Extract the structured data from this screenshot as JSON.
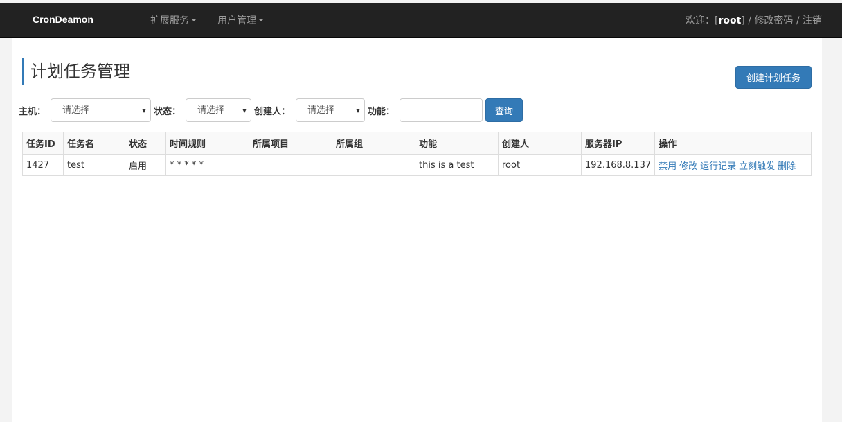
{
  "navbar": {
    "brand": "CronDeamon",
    "menu": [
      {
        "label": "扩展服务"
      },
      {
        "label": "用户管理"
      }
    ],
    "welcome_prefix": "欢迎：[",
    "username": "root",
    "welcome_suffix": "] / ",
    "change_password": "修改密码",
    "separator": " / ",
    "logout": "注销"
  },
  "page": {
    "title": "计划任务管理",
    "create_button": "创建计划任务"
  },
  "filters": {
    "host_label": "主机：",
    "host_value": "请选择",
    "status_label": "状态：",
    "status_value": "请选择",
    "creator_label": "创建人：",
    "creator_value": "请选择",
    "function_label": "功能：",
    "function_value": "",
    "query_button": "查询"
  },
  "table": {
    "headers": [
      "任务ID",
      "任务名",
      "状态",
      "时间规则",
      "所属项目",
      "所属组",
      "功能",
      "创建人",
      "服务器IP",
      "操作"
    ],
    "rows": [
      {
        "id": "1427",
        "name": "test",
        "status": "启用",
        "schedule": "* * * * *",
        "project": "",
        "group": "",
        "function": "this is a test",
        "creator": "root",
        "server_ip": "192.168.8.137",
        "actions": [
          "禁用",
          "修改",
          "运行记录",
          "立刻触发",
          "删除"
        ]
      }
    ]
  },
  "colors": {
    "navbar_bg": "#222222",
    "primary": "#337ab7"
  }
}
